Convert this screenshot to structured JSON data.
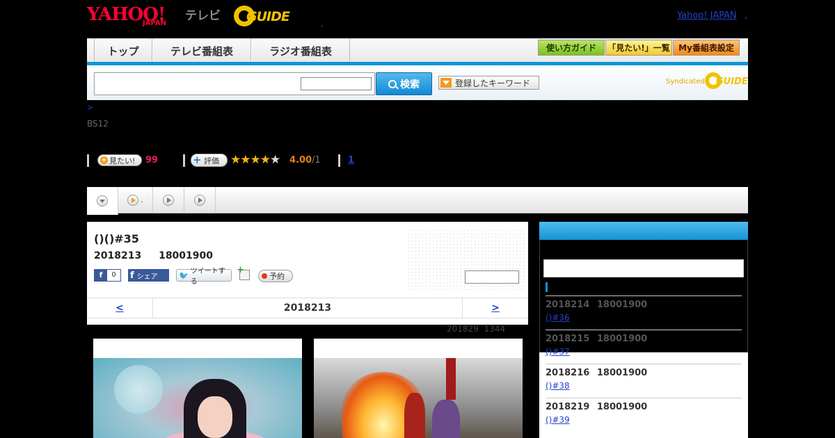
{
  "header": {
    "logo_yahoo": "YAHOO!",
    "logo_yahoo_sub": "JAPAN",
    "logo_tv": "テレビ",
    "logo_gguide": "GUIDE",
    "dot": ",",
    "yahoo_japan_link": "Yahoo! JAPAN",
    "link_sep": ","
  },
  "nav": {
    "tabs": [
      "トップ",
      "テレビ番組表",
      "ラジオ番組表"
    ],
    "buttons": [
      "使い方ガイド",
      "「見たい!」一覧",
      "My番組表設定"
    ]
  },
  "search": {
    "input_value": "",
    "select_value": "",
    "button_label": "検索",
    "keyword_button": "登録したキーワード",
    "syndicated": "Syndicated",
    "syndicated_logo": "GUIDE"
  },
  "breadcrumb": ">",
  "channel": "BS12",
  "actions": {
    "want_label": "見たい!",
    "want_count": "99",
    "rate_label": "評価",
    "stars_filled": 4,
    "stars_total": 5,
    "rating": "4.00",
    "rating_den": "/1",
    "comment_count": "1"
  },
  "tabs": {
    "tab2_dot": "."
  },
  "program": {
    "title": "()()#35",
    "date": "2018213",
    "time": "18001900",
    "fb_count": "0",
    "fb_share": "シェア",
    "tweet": "ツイートする",
    "reserve": "予約",
    "episode_select": ""
  },
  "pager": {
    "prev": "<",
    "date": "2018213",
    "next": ">"
  },
  "updated": {
    "date": "201829",
    "time": "1344"
  },
  "sidebar": {
    "episodes": [
      {
        "date": "2018214",
        "time": "18001900",
        "title": "()#36",
        "dim": true
      },
      {
        "date": "2018215",
        "time": "18001900",
        "title": "()#37",
        "dim": true
      },
      {
        "date": "2018216",
        "time": "18001900",
        "title": "()#38",
        "dim": false
      },
      {
        "date": "2018219",
        "time": "18001900",
        "title": "()#39",
        "dim": false
      }
    ]
  },
  "colors": {
    "accent_blue": "#1693d6",
    "want_count": "#e0205e",
    "rating": "#e57f14",
    "link": "#2343c8"
  }
}
